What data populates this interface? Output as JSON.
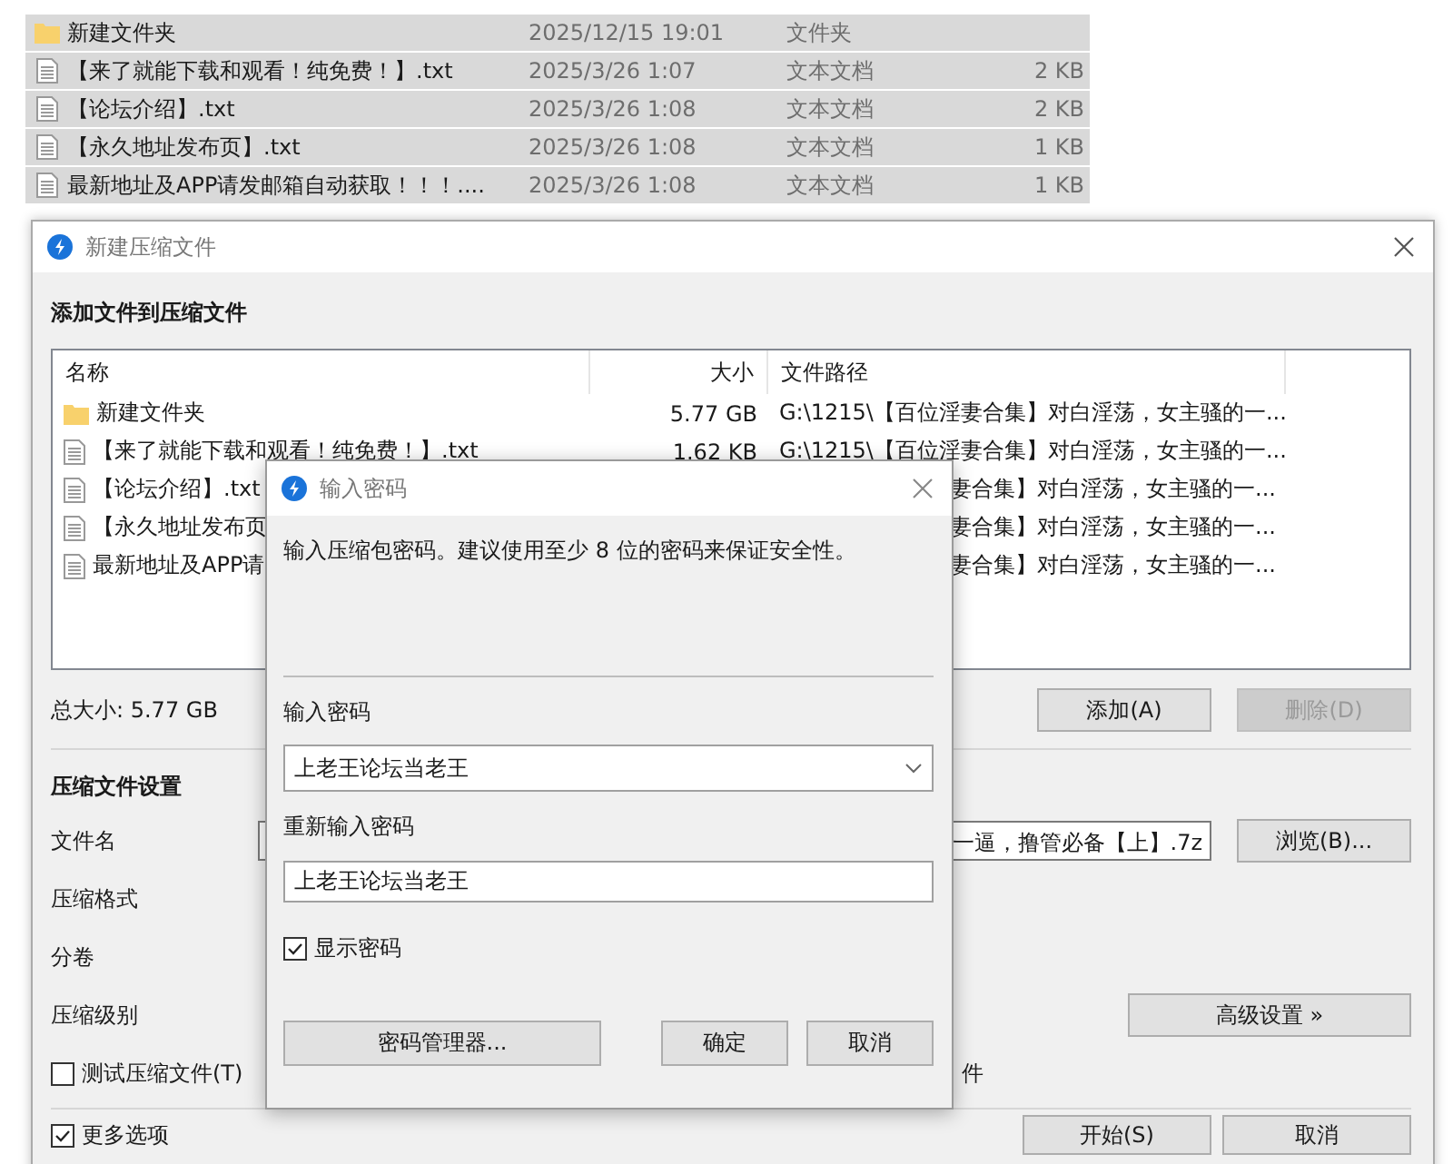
{
  "explorer": {
    "rows": [
      {
        "kind": "folder",
        "name": "新建文件夹",
        "date": "2025/12/15 19:01",
        "type": "文件夹",
        "selected": true
      },
      {
        "kind": "file",
        "name": "【来了就能下载和观看！纯免费！】.txt",
        "date": "2025/3/26 1:07",
        "type": "文本文档",
        "size": "2 KB",
        "selected": true
      },
      {
        "kind": "file",
        "name": "【论坛介绍】.txt",
        "date": "2025/3/26 1:08",
        "type": "文本文档",
        "size": "2 KB",
        "selected": true
      },
      {
        "kind": "file",
        "name": "【永久地址发布页】.txt",
        "date": "2025/3/26 1:08",
        "type": "文本文档",
        "size": "1 KB",
        "selected": true
      },
      {
        "kind": "file",
        "name": "最新地址及APP请发邮箱自动获取！！！....",
        "date": "2025/3/26 1:08",
        "type": "文本文档",
        "size": "1 KB",
        "selected": true
      }
    ]
  },
  "dialog": {
    "title": "新建压缩文件",
    "heading": "添加文件到压缩文件",
    "columns": [
      "名称",
      "大小",
      "文件路径"
    ],
    "rows": [
      {
        "kind": "folder",
        "name": "新建文件夹",
        "size": "5.77 GB",
        "path": "G:\\1215\\【百位淫妻合集】对白淫荡，女主骚的一...",
        "covered": false
      },
      {
        "kind": "file",
        "name": "【来了就能下载和观看！纯免费！】.txt",
        "size": "1.62 KB",
        "path": "G:\\1215\\【百位淫妻合集】对白淫荡，女主骚的一...",
        "covered": false
      },
      {
        "kind": "file",
        "name": "【论坛介绍】.txt",
        "path": "妻合集】对白淫荡，女主骚的一...",
        "covered": true
      },
      {
        "kind": "file",
        "name": "【永久地址发布页",
        "path": "妻合集】对白淫荡，女主骚的一...",
        "covered": true
      },
      {
        "kind": "file",
        "name": "最新地址及APP请",
        "path": "妻合集】对白淫荡，女主骚的一...",
        "covered": true
      }
    ],
    "total": "总大小: 5.77 GB",
    "list_buttons": [
      {
        "label": "添加(A)",
        "disabled": false
      },
      {
        "label": "删除(D)",
        "disabled": true
      }
    ],
    "settings_heading": "压缩文件设置",
    "labels": [
      "文件名",
      "压缩格式",
      "分卷",
      "压缩级别"
    ],
    "filename": "一逼，撸管必备【上】.7z",
    "browse_button": "浏览(B)...",
    "advanced_button": "高级设置 »",
    "test_checkbox": {
      "label": "测试压缩文件(T)",
      "checked": false
    },
    "hidden_option_tail": "件",
    "more_checkbox": {
      "label": "更多选项",
      "checked": true
    },
    "footer_buttons": [
      "开始(S)",
      "取消"
    ]
  },
  "password_dialog": {
    "title": "输入密码",
    "message": "输入压缩包密码。建议使用至少 8 位的密码来保证安全性。",
    "password_label": "输入密码",
    "password": "上老王论坛当老王",
    "confirm_label": "重新输入密码",
    "confirm": "上老王论坛当老王",
    "show_password": {
      "label": "显示密码",
      "checked": true
    },
    "buttons": [
      "密码管理器...",
      "确定",
      "取消"
    ]
  }
}
